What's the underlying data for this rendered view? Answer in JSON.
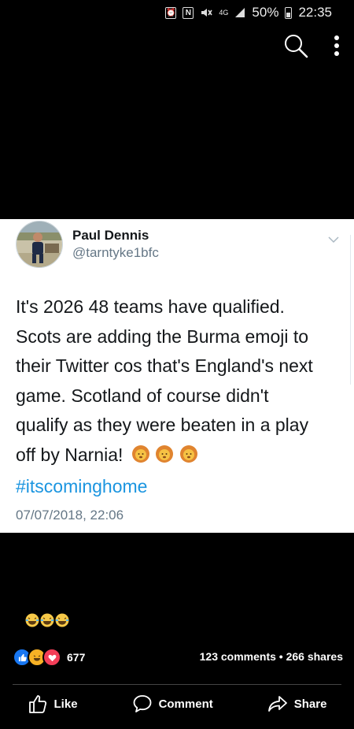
{
  "status_bar": {
    "icons": [
      "alarm-icon",
      "nfc-icon",
      "mute-icon",
      "network-4g-icon",
      "signal-icon",
      "battery-icon"
    ],
    "network": "4G",
    "battery": "50%",
    "time": "22:35"
  },
  "toolbar": {
    "icons": [
      "search-icon",
      "more-vertical-icon"
    ]
  },
  "tweet": {
    "author_name": "Paul Dennis",
    "author_handle": "@tarntyke1bfc",
    "lines": [
      "It's 2026 48 teams have qualified.",
      "Scots are adding the Burma emoji to",
      "their Twitter cos that's England's next",
      "game. Scotland of course didn't",
      "qualify as they were beaten in a play",
      "off by Narnia!"
    ],
    "hashtag": "#itscominghome",
    "timestamp": "07/07/2018, 22:06",
    "emoji": [
      "lion-icon",
      "lion-icon",
      "lion-icon"
    ]
  },
  "post": {
    "caption_emoji": [
      "laughing-icon",
      "laughing-icon",
      "laughing-icon"
    ],
    "reaction_icons": [
      "like-reaction-icon",
      "haha-reaction-icon",
      "love-reaction-icon"
    ],
    "reaction_count": "677",
    "comments": "123 comments",
    "separator": "•",
    "shares": "266 shares",
    "like_label": "Like",
    "comment_label": "Comment",
    "share_label": "Share"
  },
  "colors": {
    "background": "#000000",
    "card": "#ffffff",
    "hashtag": "#1b95e0",
    "muted": "#657786",
    "like_blue": "#1877f2",
    "love_red": "#f33e58",
    "haha_yellow": "#f7b125"
  }
}
